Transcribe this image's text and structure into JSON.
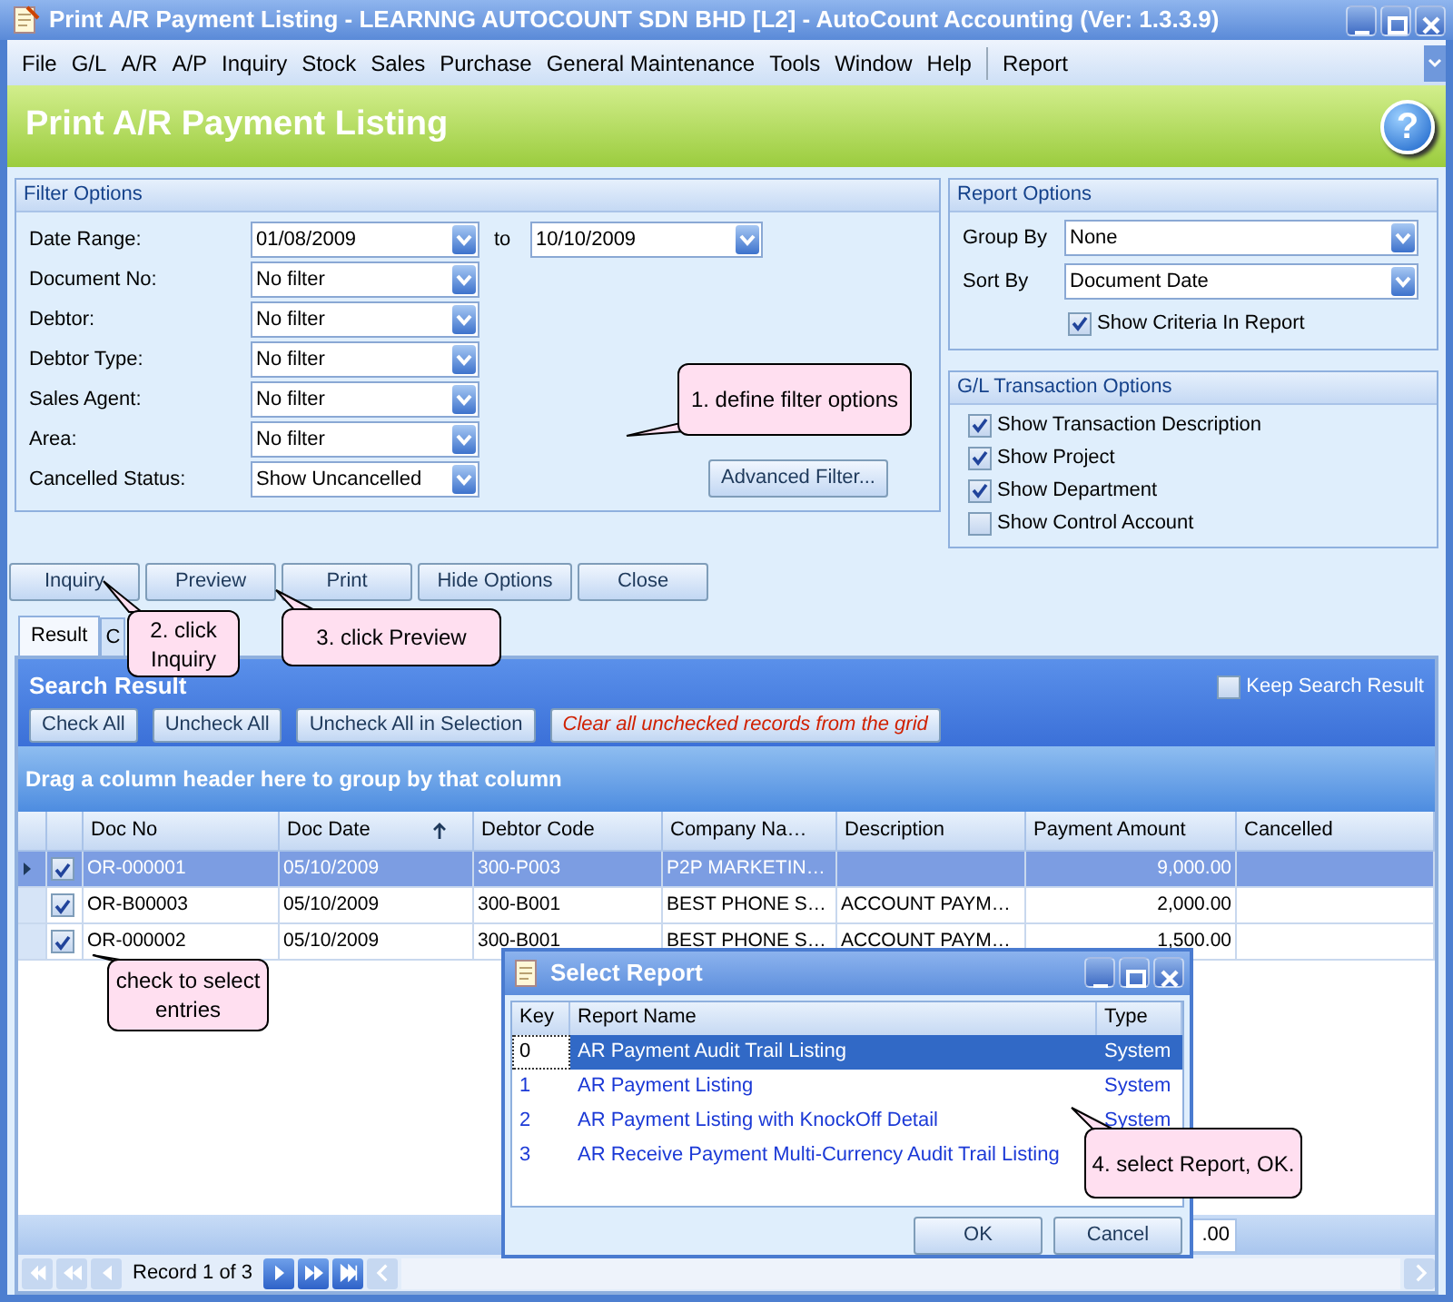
{
  "window": {
    "title": "Print A/R Payment Listing - LEARNNG AUTOCOUNT SDN BHD [L2] - AutoCount Accounting (Ver: 1.3.3.9)"
  },
  "menu": [
    "File",
    "G/L",
    "A/R",
    "A/P",
    "Inquiry",
    "Stock",
    "Sales",
    "Purchase",
    "General Maintenance",
    "Tools",
    "Window",
    "Help",
    "Report"
  ],
  "header": {
    "title": "Print A/R Payment Listing",
    "help": "?"
  },
  "filter_options": {
    "title": "Filter Options",
    "fields": [
      {
        "label": "Date Range:",
        "value": "01/08/2009",
        "to_label": "to",
        "to_value": "10/10/2009"
      },
      {
        "label": "Document No:",
        "value": "No filter"
      },
      {
        "label": "Debtor:",
        "value": "No filter"
      },
      {
        "label": "Debtor Type:",
        "value": "No filter"
      },
      {
        "label": "Sales Agent:",
        "value": "No filter"
      },
      {
        "label": "Area:",
        "value": "No filter"
      },
      {
        "label": "Cancelled Status:",
        "value": "Show Uncancelled"
      }
    ],
    "advanced_button": "Advanced Filter..."
  },
  "report_options": {
    "title": "Report Options",
    "selects": [
      {
        "label": "Group By",
        "value": "None"
      },
      {
        "label": "Sort By",
        "value": "Document Date"
      }
    ],
    "show_criteria": {
      "label": "Show Criteria In Report",
      "checked": true
    }
  },
  "gl_options": {
    "title": "G/L Transaction Options",
    "options": [
      {
        "label": "Show Transaction Description",
        "checked": true
      },
      {
        "label": "Show Project",
        "checked": true
      },
      {
        "label": "Show Department",
        "checked": true
      },
      {
        "label": "Show Control Account",
        "checked": false
      }
    ]
  },
  "action_buttons": [
    "Inquiry",
    "Preview",
    "Print",
    "Hide Options",
    "Close"
  ],
  "tabs": [
    {
      "label": "Result",
      "selected": true
    },
    {
      "label": "C",
      "selected": false
    }
  ],
  "search_result": {
    "title": "Search Result",
    "keep_search": {
      "label": "Keep Search Result",
      "checked": false
    },
    "buttons": [
      {
        "label": "Check All",
        "kind": "normal"
      },
      {
        "label": "Uncheck All",
        "kind": "normal"
      },
      {
        "label": "Uncheck All in Selection",
        "kind": "normal"
      },
      {
        "label": "Clear all unchecked records from the grid",
        "kind": "warning"
      }
    ],
    "group_hint": "Drag a column header here to group by that column",
    "columns": [
      {
        "label": "Doc No"
      },
      {
        "label": "Doc Date",
        "sorted": true
      },
      {
        "label": "Debtor Code"
      },
      {
        "label": "Company Na…"
      },
      {
        "label": "Description"
      },
      {
        "label": "Payment Amount"
      },
      {
        "label": "Cancelled"
      }
    ],
    "rows": [
      {
        "focused": true,
        "checked": true,
        "cells": [
          "OR-000001",
          "05/10/2009",
          "300-P003",
          "P2P MARKETIN…",
          "",
          "9,000.00",
          ""
        ]
      },
      {
        "focused": false,
        "checked": true,
        "cells": [
          "OR-B00003",
          "05/10/2009",
          "300-B001",
          "BEST PHONE S…",
          "ACCOUNT PAYM…",
          "2,000.00",
          ""
        ]
      },
      {
        "focused": false,
        "checked": true,
        "cells": [
          "OR-000002",
          "05/10/2009",
          "300-B001",
          "BEST PHONE S…",
          "ACCOUNT PAYM…",
          "1,500.00",
          ""
        ]
      }
    ],
    "footer_total": ".00",
    "record_label": "Record 1 of 3"
  },
  "dialog": {
    "title": "Select Report",
    "columns": [
      "Key",
      "Report Name",
      "Type"
    ],
    "rows": [
      {
        "key": "0",
        "name": "AR Payment Audit Trail Listing",
        "type": "System",
        "selected": true
      },
      {
        "key": "1",
        "name": "AR Payment Listing",
        "type": "System",
        "selected": false
      },
      {
        "key": "2",
        "name": "AR Payment Listing with KnockOff Detail",
        "type": "System",
        "selected": false
      },
      {
        "key": "3",
        "name": "AR Receive Payment Multi-Currency Audit Trail Listing",
        "selected": false
      }
    ],
    "buttons": [
      "OK",
      "Cancel"
    ]
  },
  "callouts": [
    {
      "text": "1. define filter options"
    },
    {
      "text": "2. click Inquiry"
    },
    {
      "text": "3. click Preview"
    },
    {
      "text": "check to select entries"
    },
    {
      "text": "4. select Report, OK."
    }
  ]
}
